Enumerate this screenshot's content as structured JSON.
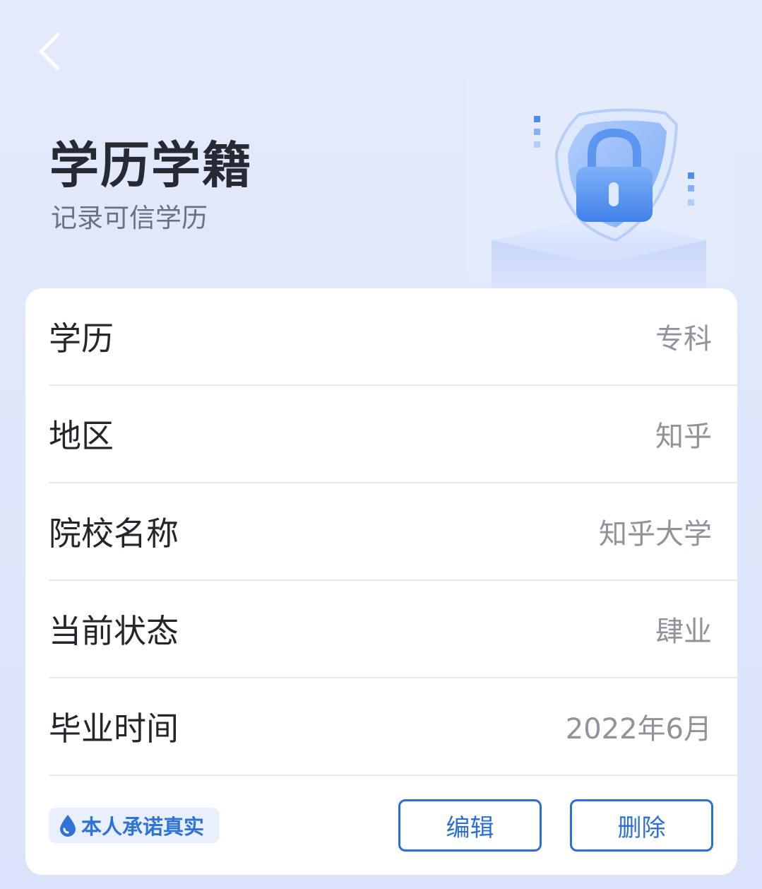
{
  "header": {
    "title": "学历学籍",
    "subtitle": "记录可信学历"
  },
  "rows": [
    {
      "label": "学历",
      "value": "专科"
    },
    {
      "label": "地区",
      "value": "知乎"
    },
    {
      "label": "院校名称",
      "value": "知乎大学"
    },
    {
      "label": "当前状态",
      "value": "肆业"
    },
    {
      "label": "毕业时间",
      "value": "2022年6月"
    }
  ],
  "footer": {
    "promise_label": "本人承诺真实",
    "edit_label": "编辑",
    "delete_label": "删除"
  },
  "icons": {
    "back": "chevron-left-icon",
    "hero": "shield-lock-icon",
    "promise": "water-drop-icon"
  },
  "colors": {
    "accent": "#2b6fd6",
    "background": "#e2e9fb",
    "card": "#ffffff",
    "label": "#23262d",
    "value": "#8f939b"
  }
}
